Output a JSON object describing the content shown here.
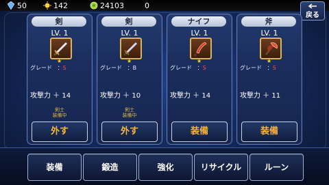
{
  "resources": {
    "crystal": "50",
    "sun": "142",
    "coin": "24103",
    "other": "0"
  },
  "back_label": "戻る",
  "cards": [
    {
      "category": "剣",
      "level": "LV. 1",
      "grade_label": "グレード",
      "grade_value": "S",
      "attack": "攻撃力 ＋ 14",
      "note_line1": "剣士",
      "note_line2": "装備中",
      "button": "外す"
    },
    {
      "category": "剣",
      "level": "LV. 1",
      "grade_label": "グレード",
      "grade_value": "B",
      "attack": "攻撃力 ＋ 10",
      "note_line1": "剣士",
      "note_line2": "装備中",
      "button": "外す"
    },
    {
      "category": "ナイフ",
      "level": "LV. 1",
      "grade_label": "グレード",
      "grade_value": "S",
      "attack": "攻撃力 ＋ 14",
      "note_line1": "",
      "note_line2": "",
      "button": "装備"
    },
    {
      "category": "斧",
      "level": "LV. 1",
      "grade_label": "グレード",
      "grade_value": "S",
      "attack": "攻撃力 ＋ 11",
      "note_line1": "",
      "note_line2": "",
      "button": "装備"
    }
  ],
  "menu": [
    "装備",
    "鍛造",
    "強化",
    "リサイクル",
    "ルーン"
  ],
  "colors": {
    "grade_s": "#ff4b4b",
    "button_text": "#ffb53b",
    "note_text": "#d9b44e"
  }
}
